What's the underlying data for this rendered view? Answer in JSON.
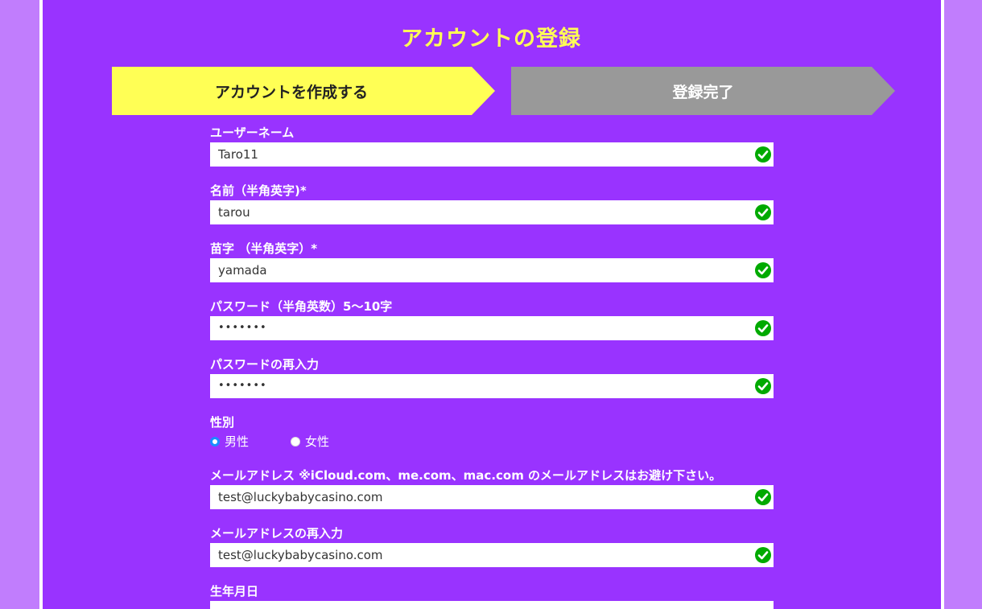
{
  "page": {
    "title": "アカウントの登録"
  },
  "steps": [
    {
      "label": "アカウントを作成する",
      "active": true,
      "color": "#ffff55"
    },
    {
      "label": "登録完了",
      "active": false,
      "color": "#999999"
    }
  ],
  "colors": {
    "background": "#c17dfd",
    "panel": "#9933ff",
    "title": "#ffff55",
    "check": "#00aa00"
  },
  "form": {
    "username": {
      "label": "ユーザーネーム",
      "value": "Taro11",
      "valid_icon": "check-circle-icon"
    },
    "first_name": {
      "label": "名前（半角英字)*",
      "value": "tarou",
      "valid_icon": "check-circle-icon"
    },
    "last_name": {
      "label": "苗字 （半角英字）*",
      "value": "yamada",
      "valid_icon": "check-circle-icon"
    },
    "password": {
      "label": "パスワード（半角英数）5〜10字",
      "value": "•••••••",
      "valid_icon": "check-circle-icon"
    },
    "password_confirm": {
      "label": "パスワードの再入力",
      "value": "•••••••",
      "valid_icon": "check-circle-icon"
    },
    "gender": {
      "label": "性別",
      "options": [
        {
          "label": "男性",
          "selected": true
        },
        {
          "label": "女性",
          "selected": false
        }
      ]
    },
    "email": {
      "label": "メールアドレス ※iCloud.com、me.com、mac.com のメールアドレスはお避け下さい。",
      "value": "test@luckybabycasino.com",
      "valid_icon": "check-circle-icon"
    },
    "email_confirm": {
      "label": "メールアドレスの再入力",
      "value": "test@luckybabycasino.com",
      "valid_icon": "check-circle-icon"
    },
    "birthdate": {
      "label": "生年月日",
      "value": ""
    }
  }
}
